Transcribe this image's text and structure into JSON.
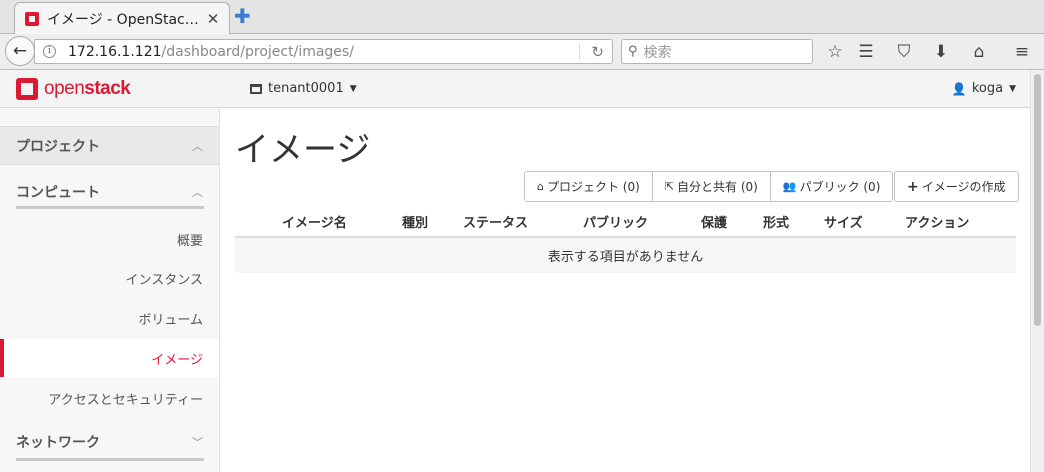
{
  "browser": {
    "tab_title": "イメージ - OpenStack Dashboard",
    "tab_title_display": "イメージ - OpenStac…",
    "url_host": "172.16.1.121",
    "url_path": "/dashboard/project/images/",
    "search_placeholder": "検索",
    "close_glyph": "✕",
    "newtab_glyph": "✚"
  },
  "header": {
    "logo_open": "open",
    "logo_stack": "stack",
    "project": "tenant0001",
    "user": "koga"
  },
  "sidebar": {
    "project_label": "プロジェクト",
    "compute_label": "コンピュート",
    "network_label": "ネットワーク",
    "items": [
      {
        "label": "概要",
        "active": false
      },
      {
        "label": "インスタンス",
        "active": false
      },
      {
        "label": "ボリューム",
        "active": false
      },
      {
        "label": "イメージ",
        "active": true
      },
      {
        "label": "アクセスとセキュリティー",
        "active": false
      }
    ]
  },
  "main": {
    "title": "イメージ",
    "filters": {
      "project": "プロジェクト (0)",
      "shared": "自分と共有 (0)",
      "public": "パブリック (0)"
    },
    "create_label": "イメージの作成",
    "table": {
      "columns": [
        "イメージ名",
        "種別",
        "ステータス",
        "パブリック",
        "保護",
        "形式",
        "サイズ",
        "アクション"
      ],
      "empty_message": "表示する項目がありません"
    }
  },
  "colors": {
    "brand": "#da1a32",
    "sidebar_bg": "#f7f7f7",
    "header_bg": "#f4f4f4"
  },
  "icons": [
    "back-arrow-icon",
    "info-icon",
    "reload-icon",
    "search-icon",
    "bookmark-star-icon",
    "reader-icon",
    "pocket-icon",
    "download-icon",
    "home-icon",
    "menu-icon",
    "user-icon",
    "home-small-icon",
    "share-icon",
    "users-icon",
    "plus-icon"
  ]
}
